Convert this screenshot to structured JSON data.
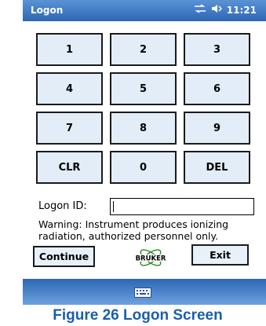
{
  "window": {
    "title": "Logon",
    "time": "11:21"
  },
  "status_icons": [
    "connectivity-icon",
    "volume-icon"
  ],
  "keypad": {
    "keys": [
      "1",
      "2",
      "3",
      "4",
      "5",
      "6",
      "7",
      "8",
      "9",
      "CLR",
      "0",
      "DEL"
    ]
  },
  "logon": {
    "label": "Logon ID:",
    "value": ""
  },
  "warning": "Warning: Instrument produces ionizing radiation, authorized personnel only.",
  "buttons": {
    "continue": "Continue",
    "exit": "Exit"
  },
  "logo": {
    "text": "BRUKER"
  },
  "taskbar": {
    "icon": "keyboard-icon"
  },
  "caption": "Figure 26  Logon Screen",
  "colors": {
    "title_bar": "#3f7cc7",
    "key_face": "#e3edf8",
    "caption": "#1b5fa8"
  }
}
